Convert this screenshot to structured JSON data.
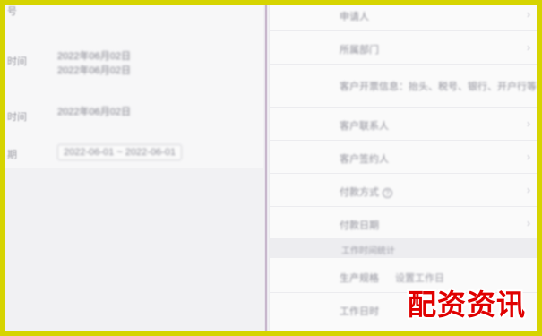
{
  "left_list": {
    "rows": [
      {
        "label": "号",
        "value": "",
        "value_line2": ""
      },
      {
        "label": "时间",
        "value": "2022年06月02日",
        "value_line2": "2022年06月02日"
      },
      {
        "label": "时间",
        "value": "2022年06月02日",
        "value_line2": ""
      },
      {
        "label": "期",
        "value": "2022-06-01 ~ 2022-06-01",
        "value_line2": ""
      }
    ]
  },
  "right_list": {
    "rows": [
      {
        "label": "申请人",
        "value": "",
        "arrow": "›"
      },
      {
        "label": "所属部门",
        "value": "",
        "arrow": "›"
      },
      {
        "label": "客户开票信息：抬头、税号、银行、开户行等",
        "value": "",
        "arrow": ""
      },
      {
        "label": "客户联系人",
        "value": "",
        "arrow": "›"
      },
      {
        "label": "客户签约人",
        "value": "",
        "arrow": "›"
      },
      {
        "label": "付款方式",
        "value": "",
        "arrow": "›",
        "help": "?"
      },
      {
        "label": "付款日期",
        "value": "",
        "arrow": "›"
      }
    ],
    "section_title": "工作时间统计",
    "extra_rows": [
      {
        "label": "生产规格",
        "value": "设置工作日",
        "arrow": ""
      },
      {
        "label": "工作日时",
        "value": "",
        "arrow": ""
      }
    ]
  },
  "watermark": "配资资讯",
  "colors": {
    "frame_border": "#d6d400",
    "watermark": "#e00000",
    "divider": "#c8b7cc"
  }
}
